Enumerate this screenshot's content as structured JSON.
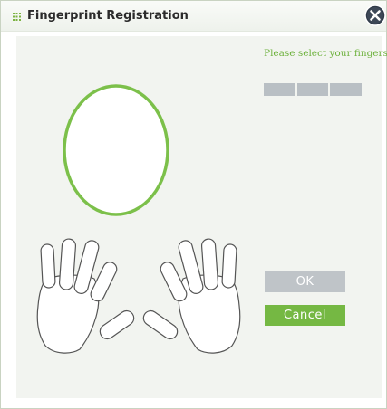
{
  "dialog": {
    "title": "Fingerprint Registration",
    "prompt": "Please select your fingers.",
    "progress_segments": 3,
    "buttons": {
      "ok_label": "OK",
      "cancel_label": "Cancel"
    }
  },
  "colors": {
    "accent_green": "#75b843",
    "prompt_green": "#6fb23f",
    "disabled_gray": "#bfc4c8",
    "preview_ring": "#7cc04a"
  },
  "icons": {
    "title": "grid-dots-icon",
    "close": "close-circle-icon"
  }
}
